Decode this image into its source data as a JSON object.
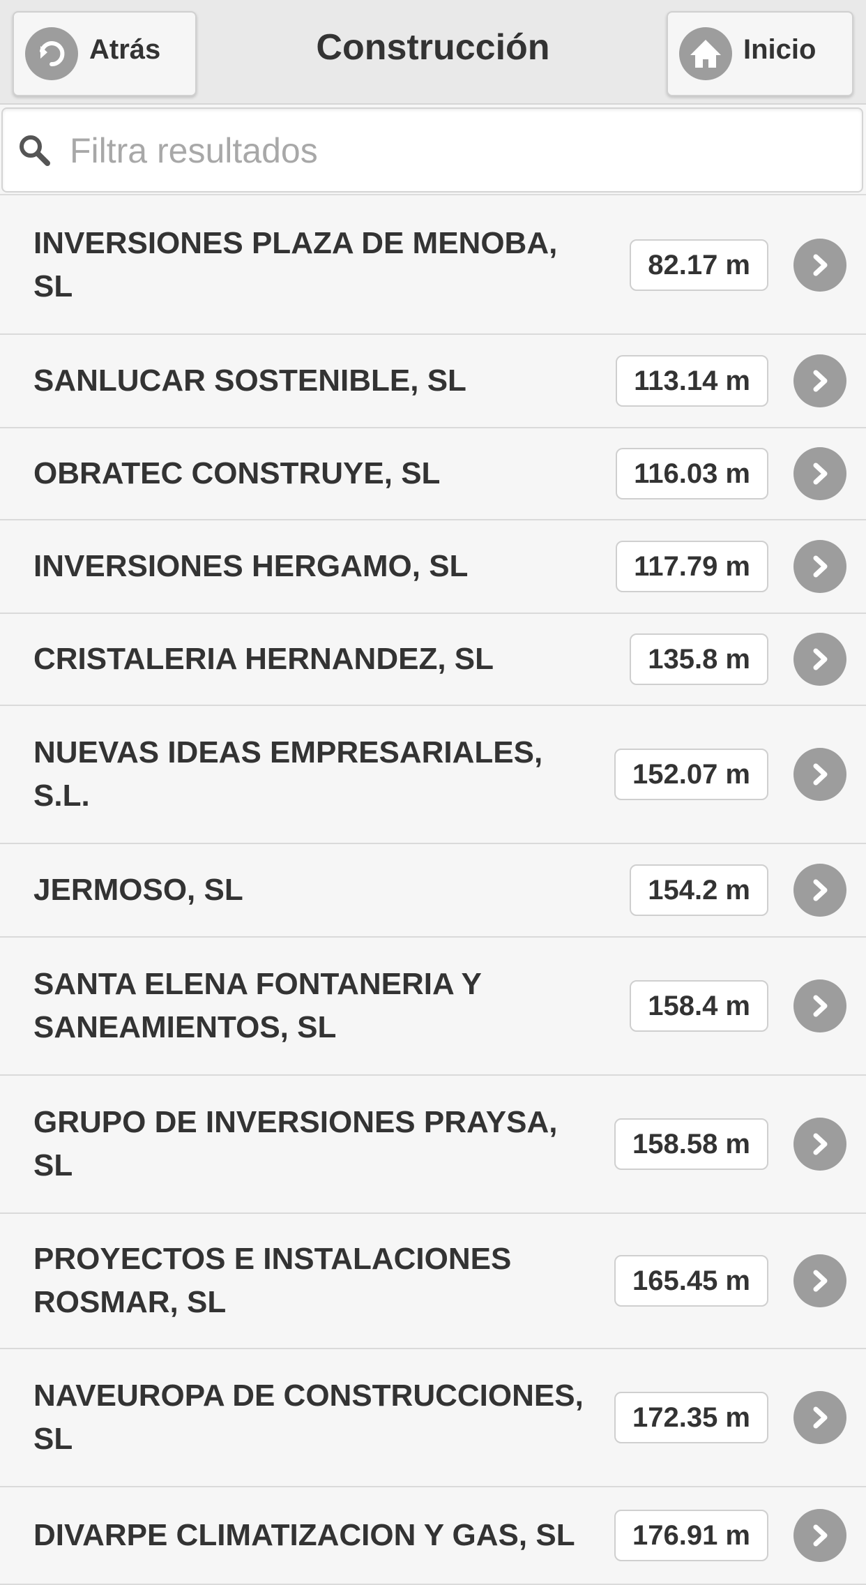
{
  "header": {
    "title": "Construcción",
    "back_label": "Atrás",
    "home_label": "Inicio"
  },
  "search": {
    "placeholder": "Filtra resultados",
    "value": ""
  },
  "icons": {
    "back": "back-arrow-icon",
    "home": "home-icon",
    "search": "search-icon",
    "row": "chevron-right-icon"
  },
  "colors": {
    "header_bg": "#e9e9e9",
    "page_bg": "#f6f6f6",
    "icon_circle": "#9d9d9d",
    "text": "#333333"
  },
  "results": [
    {
      "name": "INVERSIONES PLAZA DE MENOBA, SL",
      "distance": "82.17 m"
    },
    {
      "name": "SANLUCAR SOSTENIBLE, SL",
      "distance": "113.14 m"
    },
    {
      "name": "OBRATEC CONSTRUYE, SL",
      "distance": "116.03 m"
    },
    {
      "name": "INVERSIONES HERGAMO, SL",
      "distance": "117.79 m"
    },
    {
      "name": "CRISTALERIA HERNANDEZ, SL",
      "distance": "135.8 m"
    },
    {
      "name": "NUEVAS IDEAS EMPRESARIALES, S.L.",
      "distance": "152.07 m"
    },
    {
      "name": "JERMOSO, SL",
      "distance": "154.2 m"
    },
    {
      "name": "SANTA ELENA FONTANERIA Y SANEAMIENTOS, SL",
      "distance": "158.4 m"
    },
    {
      "name": "GRUPO DE INVERSIONES PRAYSA, SL",
      "distance": "158.58 m"
    },
    {
      "name": "PROYECTOS E INSTALACIONES ROSMAR, SL",
      "distance": "165.45 m"
    },
    {
      "name": "NAVEUROPA DE CONSTRUCCIONES, SL",
      "distance": "172.35 m"
    },
    {
      "name": "DIVARPE CLIMATIZACION Y GAS, SL",
      "distance": "176.91 m"
    }
  ]
}
